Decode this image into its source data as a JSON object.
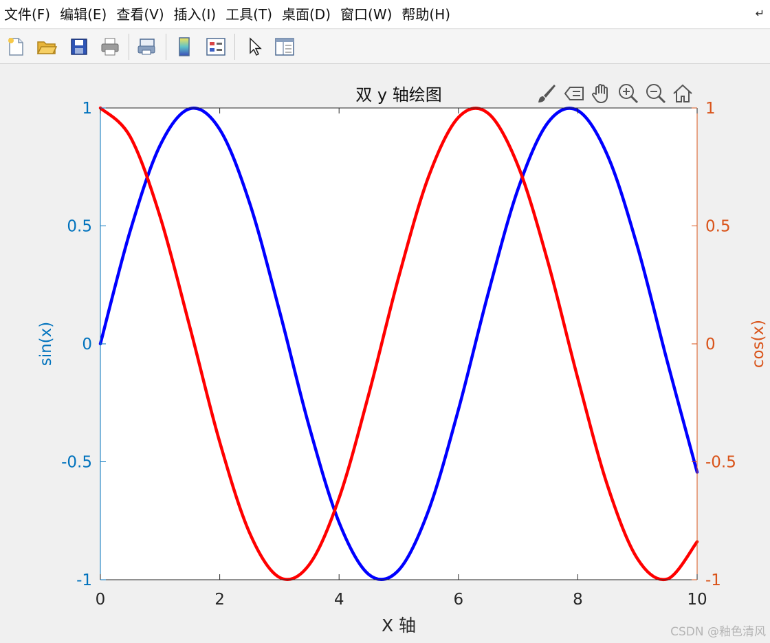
{
  "menubar": {
    "items": [
      "文件(F)",
      "编辑(E)",
      "查看(V)",
      "插入(I)",
      "工具(T)",
      "桌面(D)",
      "窗口(W)",
      "帮助(H)"
    ]
  },
  "toolbar": {
    "buttons": [
      "new-figure-icon",
      "open-file-icon",
      "save-icon",
      "print-icon",
      "link-figure-icon",
      "colorbar-icon",
      "legend-icon",
      "pointer-icon",
      "property-inspector-icon"
    ]
  },
  "axes_toolbar": {
    "buttons": [
      "brush-icon",
      "data-tips-icon",
      "pan-hand-icon",
      "zoom-in-icon",
      "zoom-out-icon",
      "home-icon"
    ]
  },
  "colors": {
    "left_axis": "#0072BD",
    "right_axis": "#D95319",
    "sin_line": "#0000FF",
    "cos_line": "#FF0000",
    "axis_dark": "#262626"
  },
  "chart_data": {
    "type": "line",
    "title": "双 y 轴绘图",
    "xlabel": "X 轴",
    "ylabel_left": "sin(x)",
    "ylabel_right": "cos(x)",
    "xlim": [
      0,
      10
    ],
    "ylim_left": [
      -1,
      1
    ],
    "ylim_right": [
      -1,
      1
    ],
    "x_ticks": [
      0,
      2,
      4,
      6,
      8,
      10
    ],
    "x_tick_labels": [
      "0",
      "2",
      "4",
      "6",
      "8",
      "10"
    ],
    "y_ticks": [
      -1,
      -0.5,
      0,
      0.5,
      1
    ],
    "y_tick_labels_left": [
      "-1",
      "-0.5",
      "0",
      "0.5",
      "1"
    ],
    "y_tick_labels_right": [
      "-1",
      "-0.5",
      "0",
      "0.5",
      "1"
    ],
    "grid": false,
    "series": [
      {
        "axis": "left",
        "color": "#0000FF",
        "x": [
          0,
          0.5,
          1,
          1.5,
          2,
          2.5,
          3,
          3.5,
          4,
          4.5,
          5,
          5.5,
          6,
          6.5,
          7,
          7.5,
          8,
          8.5,
          9,
          9.5,
          10
        ],
        "y": [
          0,
          0.479,
          0.841,
          0.997,
          0.909,
          0.598,
          0.141,
          -0.351,
          -0.757,
          -0.978,
          -0.959,
          -0.706,
          -0.279,
          0.215,
          0.657,
          0.938,
          0.989,
          0.798,
          0.412,
          -0.075,
          -0.544
        ]
      },
      {
        "axis": "right",
        "color": "#FF0000",
        "x": [
          0,
          0.5,
          1,
          1.5,
          2,
          2.5,
          3,
          3.5,
          4,
          4.5,
          5,
          5.5,
          6,
          6.5,
          7,
          7.5,
          8,
          8.5,
          9,
          9.5,
          10
        ],
        "y": [
          1,
          0.878,
          0.54,
          0.071,
          -0.416,
          -0.801,
          -0.99,
          -0.936,
          -0.654,
          -0.211,
          0.284,
          0.709,
          0.96,
          0.977,
          0.754,
          0.347,
          -0.146,
          -0.602,
          -0.911,
          -0.997,
          -0.839
        ]
      }
    ]
  },
  "watermark": "CSDN @釉色清风"
}
